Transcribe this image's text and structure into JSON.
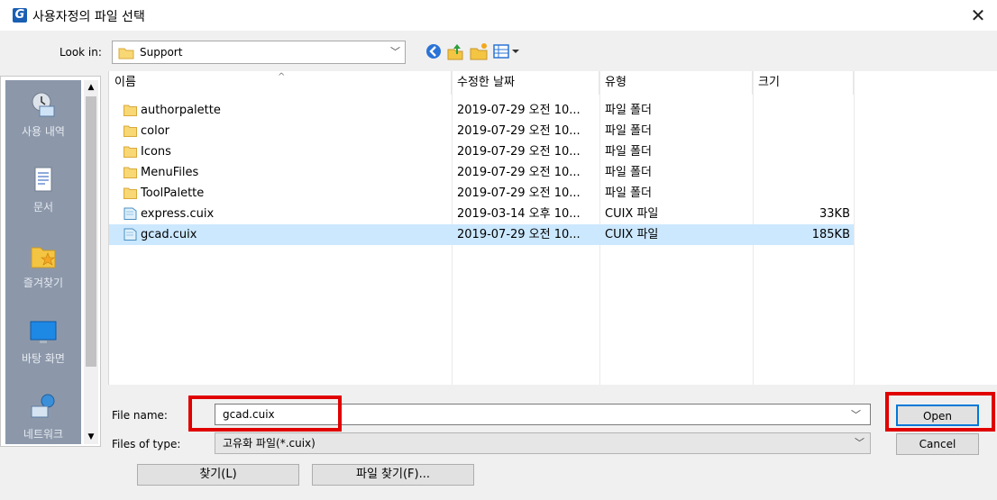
{
  "window": {
    "title": "사용자정의 파일 선택",
    "close_glyph": "✕"
  },
  "toolbar": {
    "look_in_label": "Look in:",
    "look_in_value": "Support"
  },
  "places": [
    {
      "label": "사용 내역",
      "icon": "recent-icon"
    },
    {
      "label": "문서",
      "icon": "documents-icon"
    },
    {
      "label": "즐겨찾기",
      "icon": "favorites-icon"
    },
    {
      "label": "바탕 화면",
      "icon": "desktop-icon"
    },
    {
      "label": "네트워크",
      "icon": "network-icon"
    }
  ],
  "columns": {
    "name": "이름",
    "date": "수정한 날짜",
    "type": "유형",
    "size": "크기"
  },
  "files": [
    {
      "name": "authorpalette",
      "date": "2019-07-29 오전 10...",
      "type": "파일 폴더",
      "size": "",
      "kind": "folder"
    },
    {
      "name": "color",
      "date": "2019-07-29 오전 10...",
      "type": "파일 폴더",
      "size": "",
      "kind": "folder"
    },
    {
      "name": "Icons",
      "date": "2019-07-29 오전 10...",
      "type": "파일 폴더",
      "size": "",
      "kind": "folder"
    },
    {
      "name": "MenuFiles",
      "date": "2019-07-29 오전 10...",
      "type": "파일 폴더",
      "size": "",
      "kind": "folder"
    },
    {
      "name": "ToolPalette",
      "date": "2019-07-29 오전 10...",
      "type": "파일 폴더",
      "size": "",
      "kind": "folder"
    },
    {
      "name": "express.cuix",
      "date": "2019-03-14 오후 10...",
      "type": "CUIX 파일",
      "size": "33KB",
      "kind": "file"
    },
    {
      "name": "gcad.cuix",
      "date": "2019-07-29 오전 10...",
      "type": "CUIX 파일",
      "size": "185KB",
      "kind": "file",
      "selected": true
    }
  ],
  "bottom": {
    "file_name_label": "File name:",
    "file_name_value": "gcad.cuix",
    "files_of_type_label": "Files of type:",
    "files_of_type_value": "고유화 파일(*.cuix)",
    "open_label": "Open",
    "cancel_label": "Cancel",
    "find_label": "찾기(L)",
    "find_file_label": "파일 찾기(F)..."
  },
  "colors": {
    "selection": "#cce8ff",
    "highlight": "#e00000",
    "folder": "#f8d775",
    "places_bg": "#8c98aa"
  }
}
